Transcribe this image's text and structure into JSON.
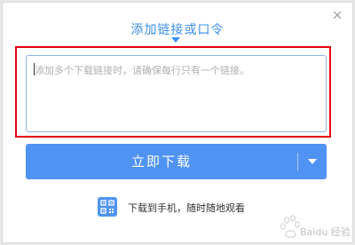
{
  "dialog": {
    "title": "添加链接或口令",
    "link_input": {
      "value": "",
      "placeholder": "添加多个下载链接时，请确保每行只有一个链接。"
    },
    "download_button": {
      "label": "立即下载"
    },
    "mobile_download": {
      "label": "下载到手机，随时随地观看"
    }
  },
  "icons": {
    "close": "close-icon",
    "dropdown": "chevron-down-icon",
    "qr": "qr-code-icon",
    "watermark": "baidu-jingyan-watermark"
  },
  "colors": {
    "accent": "#3b8ff1",
    "button": "#4f93f5",
    "highlight_frame": "#e60012",
    "input_border": "#8fb5ea"
  },
  "watermark": {
    "text": "Baidu 经验"
  }
}
